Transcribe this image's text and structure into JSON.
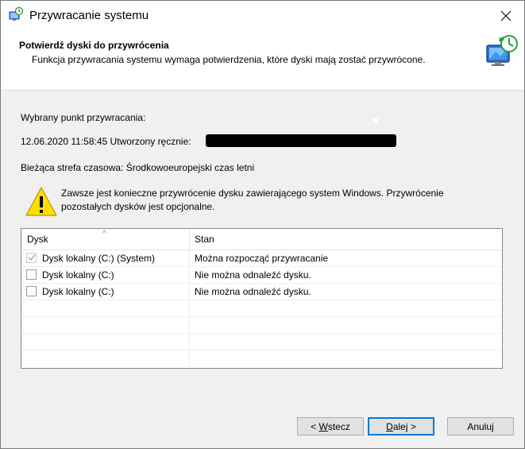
{
  "window": {
    "title": "Przywracanie systemu"
  },
  "header": {
    "title": "Potwierdź dyski do przywrócenia",
    "subtitle": "Funkcja przywracania systemu wymaga potwierdzenia, które dyski mają zostać przywrócone.",
    "icon": "system-restore-icon"
  },
  "restore_point": {
    "label": "Wybrany punkt przywracania:",
    "value": "12.06.2020 11:58:45 Utworzony ręcznie:",
    "redacted": true
  },
  "timezone": {
    "text": "Bieżąca strefa czasowa: Środkowoeuropejski czas letni"
  },
  "warning": {
    "text": "Zawsze jest konieczne przywrócenie dysku zawierającego system Windows. Przywrócenie pozostałych dysków jest opcjonalne.",
    "icon": "warning-icon",
    "icon_color": "#ffdf00"
  },
  "disk_list": {
    "columns": [
      "Dysk",
      "Stan"
    ],
    "sort_indicator": "^",
    "rows": [
      {
        "disk": "Dysk lokalny (C:) (System)",
        "status": "Można rozpocząć przywracanie",
        "checked": true,
        "disabled": true
      },
      {
        "disk": "Dysk lokalny (C:)",
        "status": "Nie można odnaleźć dysku.",
        "checked": false,
        "disabled": false
      },
      {
        "disk": "Dysk lokalny (C:)",
        "status": "Nie można odnaleźć dysku.",
        "checked": false,
        "disabled": false
      }
    ]
  },
  "buttons": {
    "back": {
      "prefix": "< ",
      "mnemonic": "W",
      "rest": "stecz"
    },
    "next": {
      "mnemonic": "D",
      "rest": "alej >"
    },
    "cancel": {
      "label": "Anuluj"
    }
  },
  "colors": {
    "accent": "#0078d7",
    "body_bg": "#f0f0f0"
  }
}
